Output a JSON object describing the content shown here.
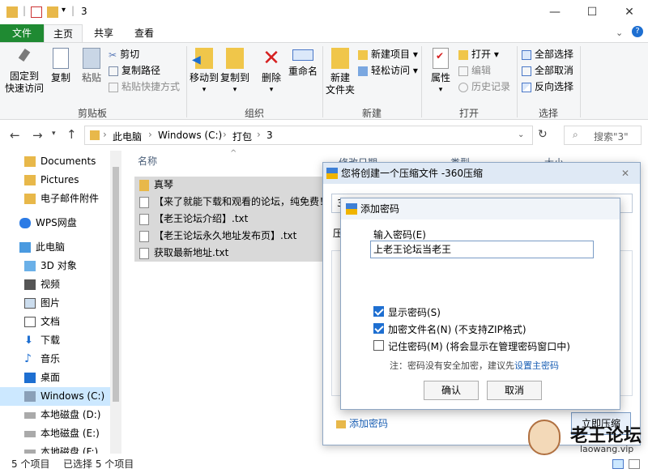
{
  "window": {
    "title": "3",
    "minimize": "—",
    "maximize": "☐",
    "close": "✕"
  },
  "ribbon": {
    "tabs": [
      "文件",
      "主页",
      "共享",
      "查看"
    ],
    "clipboard": {
      "pin": "固定到\n快速访问",
      "copy": "复制",
      "paste": "粘贴",
      "cut": "剪切",
      "copy_path": "复制路径",
      "paste_shortcut": "粘贴快捷方式",
      "label": "剪贴板"
    },
    "organize": {
      "move_to": "移动到",
      "copy_to": "复制到",
      "delete": "删除",
      "rename": "重命名",
      "label": "组织"
    },
    "new": {
      "new_folder": "新建\n文件夹",
      "new_item": "新建项目",
      "easy_access": "轻松访问",
      "label": "新建"
    },
    "open": {
      "properties": "属性",
      "open": "打开",
      "edit": "编辑",
      "history": "历史记录",
      "label": "打开"
    },
    "select": {
      "select_all": "全部选择",
      "select_none": "全部取消",
      "invert": "反向选择",
      "label": "选择"
    }
  },
  "address": {
    "path": [
      "此电脑",
      "Windows (C:)",
      "打包",
      "3"
    ],
    "search_placeholder": "搜索\"3\""
  },
  "nav": {
    "items": [
      "Documents",
      "Pictures",
      "电子邮件附件",
      "WPS网盘",
      "此电脑",
      "3D 对象",
      "视频",
      "图片",
      "文档",
      "下载",
      "音乐",
      "桌面",
      "Windows (C:)",
      "本地磁盘 (D:)",
      "本地磁盘 (E:)",
      "本地磁盘 (F:)"
    ]
  },
  "columns": {
    "name": "名称",
    "date": "修改日期",
    "type": "类型",
    "size": "大小"
  },
  "files": [
    {
      "name": "真琴",
      "kind": "folder"
    },
    {
      "name": "【来了就能下载和观看的论坛，纯免费！",
      "kind": "file"
    },
    {
      "name": "【老王论坛介绍】.txt",
      "kind": "file"
    },
    {
      "name": "【老王论坛永久地址发布页】.txt",
      "kind": "file"
    },
    {
      "name": "获取最新地址.txt",
      "kind": "file"
    }
  ],
  "status": {
    "count": "5 个项目",
    "selected": "已选择 5 个项目"
  },
  "compress_dialog": {
    "title": "您将创建一个压缩文件 -360压缩",
    "add_password": "添加密码",
    "compress_btn": "立即压缩",
    "field_prefix": "3",
    "label_prefix": "压"
  },
  "password_dialog": {
    "title": "添加密码",
    "input_label": "输入密码(E)",
    "password_value": "上老王论坛当老王",
    "show_password": "显示密码(S)",
    "encrypt_names": "加密文件名(N) (不支持ZIP格式)",
    "remember": "记住密码(M) (将会显示在管理密码窗口中)",
    "note": "注：密码没有安全加密，建议先",
    "note_link": "设置主密码",
    "ok": "确认",
    "cancel": "取消"
  },
  "watermark": {
    "brand": "老王论坛",
    "url": "laowang.vip"
  }
}
